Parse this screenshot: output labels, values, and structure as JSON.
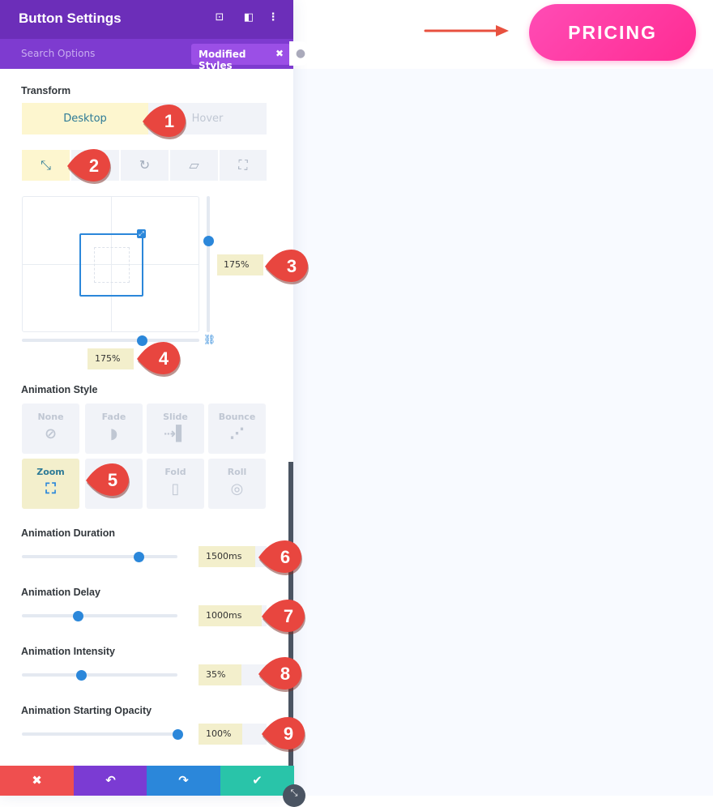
{
  "panel": {
    "title": "Button Settings",
    "header_icons": [
      "focus-icon",
      "sidebar-layout-icon",
      "more-vertical-icon"
    ],
    "search_placeholder": "Search Options",
    "filter_badge": "Modified Styles",
    "filter_close": "✖"
  },
  "transform": {
    "label": "Transform",
    "tabs": [
      {
        "label": "Desktop",
        "active": true
      },
      {
        "label": "Hover",
        "active": false
      }
    ],
    "tools": [
      "scale-icon",
      "rotate-icon",
      "skew-icon",
      "origin-icon"
    ],
    "scale_y": "175%",
    "scale_x": "175%",
    "scale_y_value": 175,
    "scale_x_value": 175
  },
  "animation_style": {
    "label": "Animation Style",
    "options": [
      {
        "label": "None",
        "icon": "none-icon",
        "glyph": "⊘"
      },
      {
        "label": "Fade",
        "icon": "fade-icon",
        "glyph": "◗"
      },
      {
        "label": "Slide",
        "icon": "slide-icon",
        "glyph": "⇢▌"
      },
      {
        "label": "Bounce",
        "icon": "bounce-icon",
        "glyph": "⋰"
      },
      {
        "label": "Zoom",
        "icon": "zoom-icon",
        "glyph": "⛶",
        "selected": true
      },
      {
        "label": "",
        "icon": "flip-icon",
        "glyph": ""
      },
      {
        "label": "Fold",
        "icon": "fold-icon",
        "glyph": "▯"
      },
      {
        "label": "Roll",
        "icon": "roll-icon",
        "glyph": "◎"
      }
    ]
  },
  "settings": [
    {
      "label": "Animation Duration",
      "value": "1500ms",
      "fraction": 0.74
    },
    {
      "label": "Animation Delay",
      "value": "1000ms",
      "fraction": 0.34
    },
    {
      "label": "Animation Intensity",
      "value": "35%",
      "fraction": 0.36
    },
    {
      "label": "Animation Starting Opacity",
      "value": "100%",
      "fraction": 1.0
    }
  ],
  "footer": {
    "cancel": "✖",
    "undo": "↶",
    "redo": "↷",
    "save": "✔"
  },
  "markers": [
    "1",
    "2",
    "3",
    "4",
    "5",
    "6",
    "7",
    "8",
    "9"
  ],
  "preview": {
    "button_label": "PRICING"
  },
  "colors": {
    "header": "#6c2eb9",
    "accent": "#2b87da",
    "marker": "#e8463f",
    "pricing": "#ff3aa6",
    "cancel": "#ef4f4f",
    "undo": "#7b3bd3",
    "redo": "#2b87da",
    "save": "#29c4a9"
  }
}
